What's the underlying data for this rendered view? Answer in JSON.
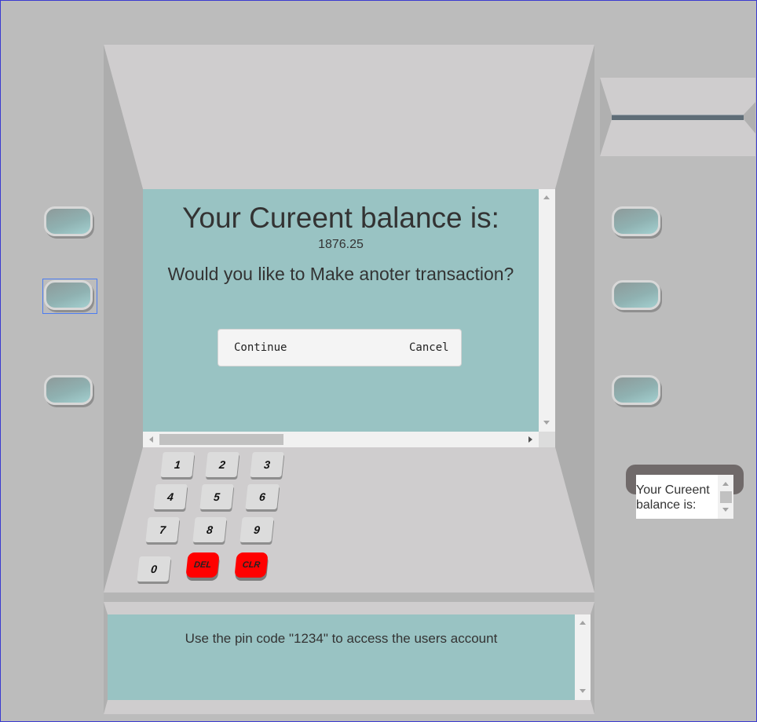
{
  "screen": {
    "title": "Your Cureent balance is:",
    "balance": "1876.25",
    "question": "Would you like to Make anoter transaction?"
  },
  "dialog": {
    "continue_label": "Continue",
    "cancel_label": "Cancel"
  },
  "keypad": {
    "keys": [
      "1",
      "2",
      "3",
      "4",
      "5",
      "6",
      "7",
      "8",
      "9",
      "0",
      "DEL",
      "CLR"
    ]
  },
  "receipt": {
    "text": "Your Cureent balance is:"
  },
  "info": {
    "text": "Use the pin code \"1234\" to access the users account"
  },
  "colors": {
    "screen": "#99c3c3",
    "body": "#bcbcbc",
    "panel": "#cfcdce",
    "key_red": "#ff0000"
  },
  "icons": {
    "side_buttons": "rounded-cyan-button",
    "scroll_arrows": [
      "arrow-up-icon",
      "arrow-down-icon",
      "arrow-left-icon",
      "arrow-right-icon"
    ]
  }
}
